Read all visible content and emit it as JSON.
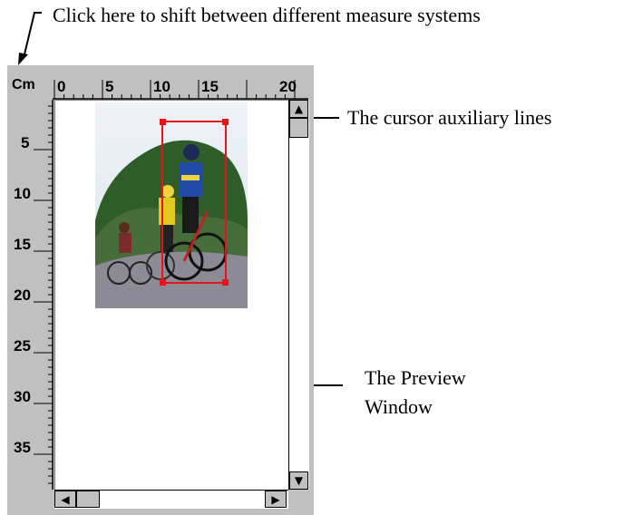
{
  "annotations": {
    "unit_hint": "Click here to shift between different measure systems",
    "cursor_lines": "The cursor auxiliary lines",
    "preview_line1": "The Preview",
    "preview_line2": "Window"
  },
  "ruler": {
    "unit_label": "Cm",
    "top_labels": [
      "0",
      "5",
      "10",
      "15",
      "20"
    ],
    "left_labels": [
      "5",
      "10",
      "15",
      "20",
      "25",
      "30",
      "35"
    ]
  },
  "scrollbars": {
    "vertical": {
      "up_icon": "arrow-up-icon",
      "down_icon": "arrow-down-icon"
    },
    "horizontal": {
      "left_icon": "arrow-left-icon",
      "right_icon": "arrow-right-icon"
    }
  },
  "colors": {
    "frame": "#c0c0c0",
    "selection": "#e8141b",
    "preview_bg": "#ffffff"
  }
}
